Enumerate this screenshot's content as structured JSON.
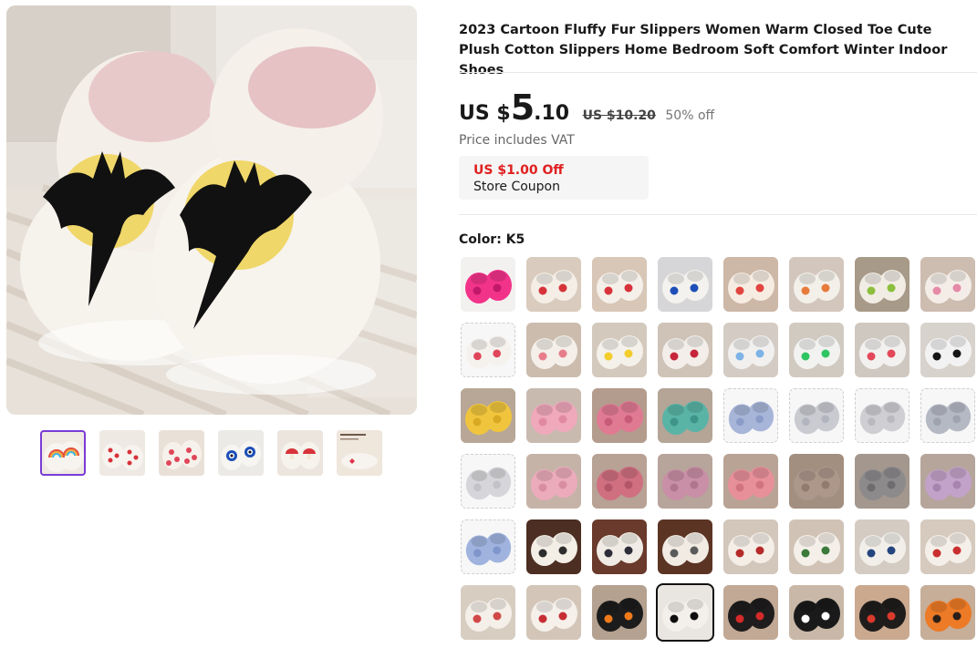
{
  "product": {
    "title": "2023 Cartoon Fluffy Fur Slippers Women Warm Closed Toe Cute Plush Cotton Slippers Home Bedroom Soft Comfort Winter Indoor Shoes",
    "main_image_icon": "bat-slippers-image"
  },
  "price": {
    "currency": "US $",
    "integer": "5",
    "decimal": ".10",
    "original": "US $10.20",
    "discount": "50% off",
    "vat_note": "Price includes VAT"
  },
  "coupon": {
    "amount": "US $1.00 Off",
    "label": "Store Coupon"
  },
  "color": {
    "label": "Color: K5"
  },
  "thumbnails": [
    {
      "name": "rainbow",
      "active": true
    },
    {
      "name": "red-hearts"
    },
    {
      "name": "strawberry"
    },
    {
      "name": "evil-eye"
    },
    {
      "name": "mushroom"
    },
    {
      "name": "size-chart"
    }
  ],
  "swatches": [
    {
      "name": "pink-slide",
      "bg": "#f3f1ef",
      "body": "#f2338a",
      "accent": "#c2186b"
    },
    {
      "name": "mushroom",
      "bg": "#d9cbbd",
      "body": "#f4eee6",
      "accent": "#d6333a"
    },
    {
      "name": "red-hearts",
      "bg": "#d8c6b6",
      "body": "#f4efe9",
      "accent": "#d8323b"
    },
    {
      "name": "evil-eye",
      "bg": "#d6d6d8",
      "body": "#f4f2ee",
      "accent": "#1e4fb8"
    },
    {
      "name": "big-heart",
      "bg": "#cdb7a7",
      "body": "#f6ece2",
      "accent": "#e2443f"
    },
    {
      "name": "rainbow-white",
      "bg": "#d3c7bd",
      "body": "#f3efe9",
      "accent": "#e77b3c"
    },
    {
      "name": "avocado",
      "bg": "#a89a88",
      "body": "#f1ece4",
      "accent": "#8bbf3c"
    },
    {
      "name": "pink-bow",
      "bg": "#cdbcb0",
      "body": "#f4ede7",
      "accent": "#e58aa8"
    },
    {
      "name": "strawberry-white",
      "bg": "#f7f7f7",
      "body": "#f5f2ee",
      "accent": "#e0465a",
      "dashed": true
    },
    {
      "name": "pink-dots",
      "bg": "#cbbcae",
      "body": "#f4efe9",
      "accent": "#e77d8b"
    },
    {
      "name": "yellow-flowers",
      "bg": "#d4c9bd",
      "body": "#f4f0ea",
      "accent": "#f2cd2b"
    },
    {
      "name": "strawberries",
      "bg": "#cfc3b7",
      "body": "#f3eee9",
      "accent": "#c7263a"
    },
    {
      "name": "blue-check",
      "bg": "#d4ccc4",
      "body": "#f1f0ee",
      "accent": "#7db3e6"
    },
    {
      "name": "green-check",
      "bg": "#d1cac1",
      "body": "#f2f2f0",
      "accent": "#2fc563"
    },
    {
      "name": "red-check",
      "bg": "#cfc8c1",
      "body": "#f3f1ef",
      "accent": "#e3485a"
    },
    {
      "name": "black-check",
      "bg": "#d8d2cc",
      "body": "#f2f2f2",
      "accent": "#151515"
    },
    {
      "name": "yellow",
      "bg": "#b8a796",
      "body": "#f0c53d",
      "accent": "#d9a922"
    },
    {
      "name": "pink",
      "bg": "#c9bab0",
      "body": "#f0a8bb",
      "accent": "#e08aa1"
    },
    {
      "name": "hot-pink",
      "bg": "#b39c8d",
      "body": "#e07a93",
      "accent": "#c85b78"
    },
    {
      "name": "teal",
      "bg": "#b4a597",
      "body": "#59b4a6",
      "accent": "#3e9488"
    },
    {
      "name": "periwinkle",
      "bg": "#f7f7f7",
      "body": "#a7b5d8",
      "accent": "#8c9cc8",
      "dashed": true
    },
    {
      "name": "light-grey",
      "bg": "#f7f7f7",
      "body": "#c9cbd1",
      "accent": "#b2b5bd",
      "dashed": true
    },
    {
      "name": "silver",
      "bg": "#f7f7f7",
      "body": "#cfcfd3",
      "accent": "#b9b9bf",
      "dashed": true
    },
    {
      "name": "blue-grey",
      "bg": "#f7f7f7",
      "body": "#b5b9c4",
      "accent": "#9ea3b0",
      "dashed": true
    },
    {
      "name": "white-grey",
      "bg": "#f7f7f7",
      "body": "#d6d6da",
      "accent": "#c2c2c8",
      "dashed": true
    },
    {
      "name": "blush",
      "bg": "#c6b3a8",
      "body": "#ecabbb",
      "accent": "#d88ea2"
    },
    {
      "name": "rose",
      "bg": "#b8a195",
      "body": "#cf6f80",
      "accent": "#b4566a"
    },
    {
      "name": "mauve",
      "bg": "#b7a49a",
      "body": "#c98fa6",
      "accent": "#b0768e"
    },
    {
      "name": "coral",
      "bg": "#b9a394",
      "body": "#e8909a",
      "accent": "#d07580"
    },
    {
      "name": "taupe",
      "bg": "#a28f80",
      "body": "#ad978b",
      "accent": "#917b70"
    },
    {
      "name": "grey-fur",
      "bg": "#a3978e",
      "body": "#8d8a8c",
      "accent": "#6f6c6f"
    },
    {
      "name": "lilac",
      "bg": "#b5a59b",
      "body": "#c3a2c9",
      "accent": "#a684ae"
    },
    {
      "name": "blue-slide",
      "bg": "#f7f7f7",
      "body": "#9fb3de",
      "accent": "#7f96cc",
      "dashed": true
    },
    {
      "name": "moon-brown",
      "bg": "#4c2e22",
      "body": "#f3eee6",
      "accent": "#2d2d2d"
    },
    {
      "name": "eye-black",
      "bg": "#6a3a2c",
      "body": "#f0ebe4",
      "accent": "#2d2d3a"
    },
    {
      "name": "moon-cream",
      "bg": "#5c3424",
      "body": "#f1ebe3",
      "accent": "#5b5b5b"
    },
    {
      "name": "reindeer",
      "bg": "#d3c6ba",
      "body": "#f4eee7",
      "accent": "#b62a2a"
    },
    {
      "name": "green-deer",
      "bg": "#d0c3b6",
      "body": "#f4efe8",
      "accent": "#3b7a3a"
    },
    {
      "name": "blue-eye",
      "bg": "#d4cbc2",
      "body": "#f2efea",
      "accent": "#24457e"
    },
    {
      "name": "santa-white",
      "bg": "#d6cabe",
      "body": "#f4efe8",
      "accent": "#c92f2f"
    },
    {
      "name": "santa-face",
      "bg": "#d8cdc1",
      "body": "#f4efe8",
      "accent": "#d14848"
    },
    {
      "name": "santa-claus",
      "bg": "#d3c6b9",
      "body": "#f5f0ea",
      "accent": "#c62e33"
    },
    {
      "name": "pumpkin-black",
      "bg": "#b4a18f",
      "body": "#1c1c1c",
      "accent": "#f07a1a"
    },
    {
      "name": "bat-k5",
      "bg": "#e9e6e1",
      "body": "#f3efea",
      "accent": "#0e0e0e",
      "selected": true
    },
    {
      "name": "red-devil",
      "bg": "#c2a995",
      "body": "#1e1c1c",
      "accent": "#d42a2a"
    },
    {
      "name": "skeleton",
      "bg": "#c9b8a7",
      "body": "#1a1a1a",
      "accent": "#ffffff"
    },
    {
      "name": "skull-black",
      "bg": "#caa98f",
      "body": "#1f1c1c",
      "accent": "#d93a2b"
    },
    {
      "name": "pumpkin-orange",
      "bg": "#c6ae99",
      "body": "#ec7a26",
      "accent": "#2a1f18"
    }
  ]
}
